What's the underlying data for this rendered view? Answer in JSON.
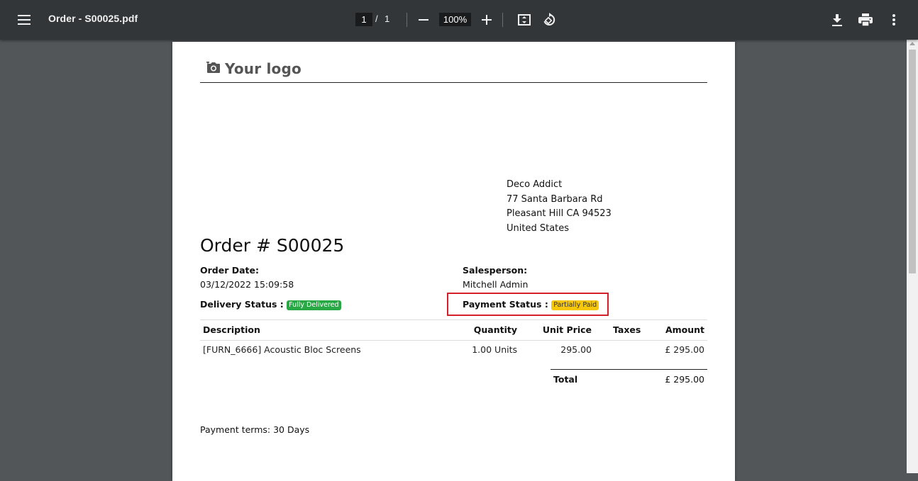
{
  "viewer": {
    "title": "Order - S00025.pdf",
    "page_current": "1",
    "page_separator": "/",
    "page_total": "1",
    "zoom": "100%"
  },
  "icons": {
    "menu": "hamburger-menu-icon",
    "zoom_out": "minus-icon",
    "zoom_in": "plus-icon",
    "fit": "fit-to-page-icon",
    "rotate": "rotate-counterclockwise-icon",
    "download": "download-icon",
    "print": "print-icon",
    "more": "more-vert-icon",
    "logo": "camera-icon"
  },
  "document": {
    "logo_text": "Your logo",
    "customer": {
      "name": "Deco Addict",
      "street": "77 Santa Barbara Rd",
      "city": "Pleasant Hill CA 94523",
      "country": "United States"
    },
    "title": "Order # S00025",
    "order_date_label": "Order Date:",
    "order_date": "03/12/2022 15:09:58",
    "salesperson_label": "Salesperson:",
    "salesperson": "Mitchell Admin",
    "delivery_status_label": "Delivery Status :",
    "delivery_status": "Fully Delivered",
    "payment_status_label": "Payment Status :",
    "payment_status": "Partially Paid",
    "table": {
      "headers": {
        "description": "Description",
        "quantity": "Quantity",
        "unit_price": "Unit Price",
        "taxes": "Taxes",
        "amount": "Amount"
      },
      "rows": [
        {
          "description": "[FURN_6666] Acoustic Bloc Screens",
          "quantity": "1.00 Units",
          "unit_price": "295.00",
          "taxes": "",
          "amount": "£ 295.00"
        }
      ]
    },
    "total_label": "Total",
    "total_value": "£ 295.00",
    "payment_terms": "Payment terms: 30 Days"
  },
  "colors": {
    "toolbar_bg": "#323639",
    "viewer_bg": "#525659",
    "badge_delivered": "#28a745",
    "badge_partially_paid": "#f7c70c",
    "highlight_border": "#d3202a"
  }
}
